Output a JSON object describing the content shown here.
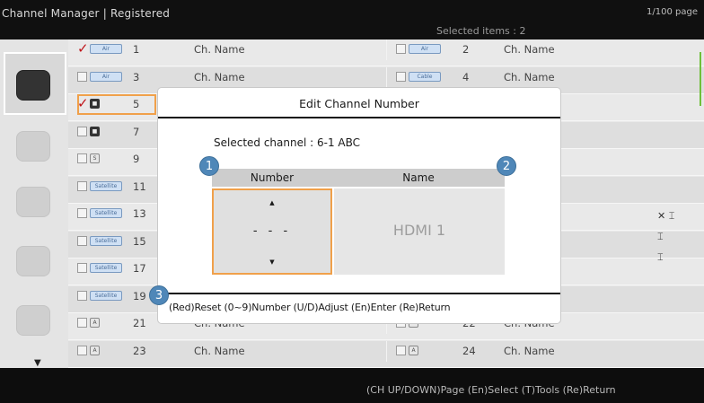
{
  "header": {
    "title": "Channel Manager | Registered",
    "selected_items": "Selected items : 2",
    "page_counter": "1/100 page"
  },
  "channels": {
    "left": [
      {
        "num": "1",
        "name": "Ch. Name",
        "checked": true,
        "tag": "Air"
      },
      {
        "num": "3",
        "name": "Ch. Name",
        "checked": false,
        "tag": "Air"
      },
      {
        "num": "5",
        "name": "",
        "checked": true,
        "tag": "dark"
      },
      {
        "num": "7",
        "name": "",
        "checked": false,
        "tag": "dark"
      },
      {
        "num": "9",
        "name": "",
        "checked": false,
        "tag": "sq"
      },
      {
        "num": "11",
        "name": "",
        "checked": false,
        "tag": "Satellite"
      },
      {
        "num": "13",
        "name": "",
        "checked": false,
        "tag": "Satellite"
      },
      {
        "num": "15",
        "name": "",
        "checked": false,
        "tag": "Satellite"
      },
      {
        "num": "17",
        "name": "",
        "checked": false,
        "tag": "Satellite"
      },
      {
        "num": "19",
        "name": "",
        "checked": false,
        "tag": "Satellite"
      },
      {
        "num": "21",
        "name": "Ch. Name",
        "checked": false,
        "tag": "A"
      },
      {
        "num": "23",
        "name": "Ch. Name",
        "checked": false,
        "tag": "A"
      }
    ],
    "right": [
      {
        "num": "2",
        "name": "Ch. Name",
        "tag": "Air"
      },
      {
        "num": "4",
        "name": "Ch. Name",
        "tag": "Cable"
      },
      {
        "num": "",
        "name": "",
        "tag": ""
      },
      {
        "num": "",
        "name": "",
        "tag": ""
      },
      {
        "num": "",
        "name": "",
        "tag": ""
      },
      {
        "num": "",
        "name": "",
        "tag": ""
      },
      {
        "num": "",
        "name": "",
        "tag": ""
      },
      {
        "num": "",
        "name": "",
        "tag": ""
      },
      {
        "num": "",
        "name": "",
        "tag": ""
      },
      {
        "num": "",
        "name": "",
        "tag": ""
      },
      {
        "num": "22",
        "name": "Ch. Name",
        "tag": "A"
      },
      {
        "num": "24",
        "name": "Ch. Name",
        "tag": "A"
      }
    ]
  },
  "footer": {
    "help": "(CH UP/DOWN)Page  (En)Select  (T)Tools  (Re)Return"
  },
  "dialog": {
    "title": "Edit Channel Number",
    "selected_channel": "Selected channel : 6-1 ABC",
    "col_number": "Number",
    "col_name": "Name",
    "number_value": "- - -",
    "up_arrow": "▲",
    "down_arrow": "▼",
    "name_value": "HDMI 1",
    "help": "(Red)Reset  (0~9)Number  (U/D)Adjust  (En)Enter  (Re)Return"
  },
  "badges": [
    "1",
    "2",
    "3"
  ],
  "strip": {
    "arrow": "▼"
  },
  "colors": {
    "accent_orange": "#f0a04a",
    "badge_blue": "#4f87b8",
    "check_red": "#c0151a"
  }
}
